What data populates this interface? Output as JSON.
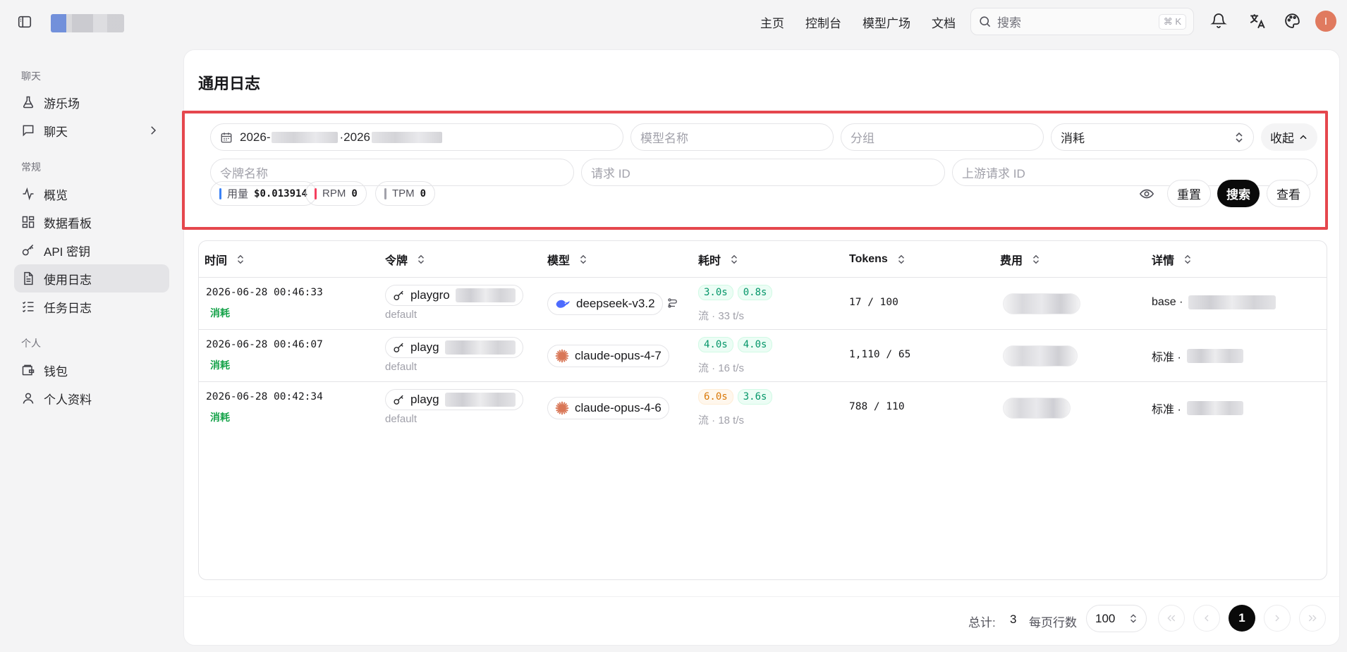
{
  "topnav": {
    "items": [
      "主页",
      "控制台",
      "模型广场",
      "文档"
    ]
  },
  "search": {
    "placeholder": "搜索",
    "shortcut": "⌘ K"
  },
  "user": {
    "avatar_initial": "I"
  },
  "sidebar": {
    "sections": [
      {
        "title": "聊天",
        "items": [
          {
            "label": "游乐场",
            "icon": "flask-icon"
          },
          {
            "label": "聊天",
            "icon": "message-icon",
            "has_children": true
          }
        ]
      },
      {
        "title": "常规",
        "items": [
          {
            "label": "概览",
            "icon": "activity-icon"
          },
          {
            "label": "数据看板",
            "icon": "dashboard-icon"
          },
          {
            "label": "API 密钥",
            "icon": "key-icon"
          },
          {
            "label": "使用日志",
            "icon": "document-icon",
            "active": true
          },
          {
            "label": "任务日志",
            "icon": "list-check-icon"
          }
        ]
      },
      {
        "title": "个人",
        "items": [
          {
            "label": "钱包",
            "icon": "wallet-icon"
          },
          {
            "label": "个人资料",
            "icon": "user-icon"
          }
        ]
      }
    ]
  },
  "page": {
    "title": "通用日志"
  },
  "filters": {
    "date_start_prefix": "2026-",
    "date_sep": "·",
    "date_end_prefix": "2026",
    "model_placeholder": "模型名称",
    "group_placeholder": "分组",
    "log_type_value": "消耗",
    "collapse_label": "收起",
    "token_placeholder": "令牌名称",
    "request_id_placeholder": "请求 ID",
    "upstream_request_id_placeholder": "上游请求 ID"
  },
  "stats": {
    "usage_label": "用量",
    "usage_value": "$0.013914",
    "rpm_label": "RPM",
    "rpm_value": "0",
    "tpm_label": "TPM",
    "tpm_value": "0",
    "colors": {
      "usage": "#3b82f6",
      "rpm": "#f43f5e",
      "tpm": "#a1a1aa"
    }
  },
  "actions": {
    "reset_label": "重置",
    "search_label": "搜索",
    "view_label": "查看"
  },
  "table": {
    "headers": [
      "时间",
      "令牌",
      "模型",
      "耗时",
      "Tokens",
      "费用",
      "详情"
    ],
    "rows": [
      {
        "time": "2026-06-28 00:46:33",
        "type": "消耗",
        "token_name": "playgro",
        "group": "default",
        "model": "deepseek-v3.2",
        "model_icon": "deepseek-whale-icon",
        "first_time": "3.0s",
        "total_time": "0.8s",
        "first_time_color": "green",
        "stream": "流 · 33 t/s",
        "tokens": "17 / 100",
        "detail_prefix": "base ·"
      },
      {
        "time": "2026-06-28 00:46:07",
        "type": "消耗",
        "token_name": "playg",
        "group": "default",
        "model": "claude-opus-4-7",
        "model_icon": "claude-spark-icon",
        "first_time": "4.0s",
        "total_time": "4.0s",
        "first_time_color": "green",
        "stream": "流 · 16 t/s",
        "tokens": "1,110 / 65",
        "detail_prefix": "标准 ·"
      },
      {
        "time": "2026-06-28 00:42:34",
        "type": "消耗",
        "token_name": "playg",
        "group": "default",
        "model": "claude-opus-4-6",
        "model_icon": "claude-spark-icon",
        "first_time": "6.0s",
        "total_time": "3.6s",
        "first_time_color": "orange",
        "stream": "流 · 18 t/s",
        "tokens": "788 / 110",
        "detail_prefix": "标准 ·"
      }
    ]
  },
  "pagination": {
    "total_label": "总计:",
    "total": "3",
    "per_page_label": "每页行数",
    "per_page": "100",
    "current_page": "1"
  }
}
